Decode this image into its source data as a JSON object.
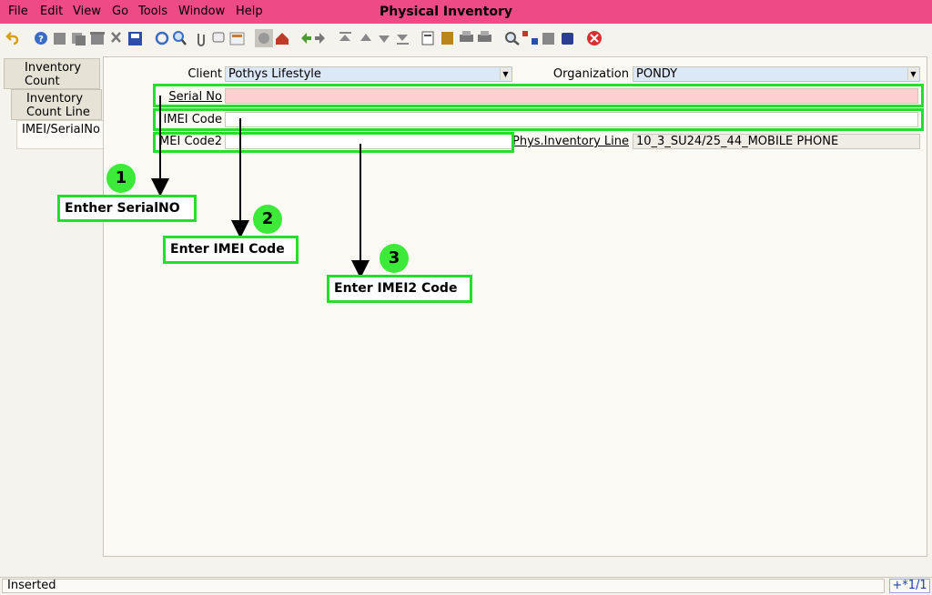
{
  "window": {
    "title": "Physical Inventory"
  },
  "menu": [
    {
      "label": "File"
    },
    {
      "label": "Edit"
    },
    {
      "label": "View"
    },
    {
      "label": "Go"
    },
    {
      "label": "Tools"
    },
    {
      "label": "Window"
    },
    {
      "label": "Help"
    }
  ],
  "toolbar": [
    "undo-icon",
    "help-icon",
    "new-record-icon",
    "copy-record-icon",
    "delete-icon",
    "delete-selection-icon",
    "save-icon",
    "refresh-icon",
    "find-icon",
    "attachment-icon",
    "chat-icon",
    "grid-toggle-icon",
    "history-icon",
    "home-icon",
    "back-icon",
    "forward-icon",
    "first-record-icon",
    "previous-record-icon",
    "next-record-icon",
    "last-record-icon",
    "report-icon",
    "archive-icon",
    "print-icon",
    "print-preview-icon",
    "zoom-across-icon",
    "workflow-icon",
    "product-info-icon",
    "process-icon",
    "end-icon"
  ],
  "tabs": [
    {
      "label": "Inventory Count"
    },
    {
      "label": "Inventory Count Line"
    },
    {
      "label": "IMEI/SerialNo"
    }
  ],
  "form": {
    "client_label": "Client",
    "client_value": "Pothys Lifestyle",
    "org_label": "Organization",
    "org_value": "PONDY",
    "serial_label": "Serial No",
    "serial_value": "",
    "imei_label": "IMEI Code",
    "imei_value": "",
    "imei2_label": "MEI Code2",
    "imei2_value": "",
    "phys_label": "Phys.Inventory Line",
    "phys_value": "10_3_SU24/25_44_MOBILE PHONE"
  },
  "annotations": [
    {
      "number": "1",
      "text": "Enther SerialNO"
    },
    {
      "number": "2",
      "text": "Enter IMEI Code"
    },
    {
      "number": "3",
      "text": "Enter IMEI2 Code"
    }
  ],
  "status": {
    "text": "Inserted",
    "nav": "+*1/1"
  },
  "colors": {
    "titlebar": "#ee4a86",
    "mandatory_field": "#fcd0d0",
    "highlight": "#22e02a"
  }
}
